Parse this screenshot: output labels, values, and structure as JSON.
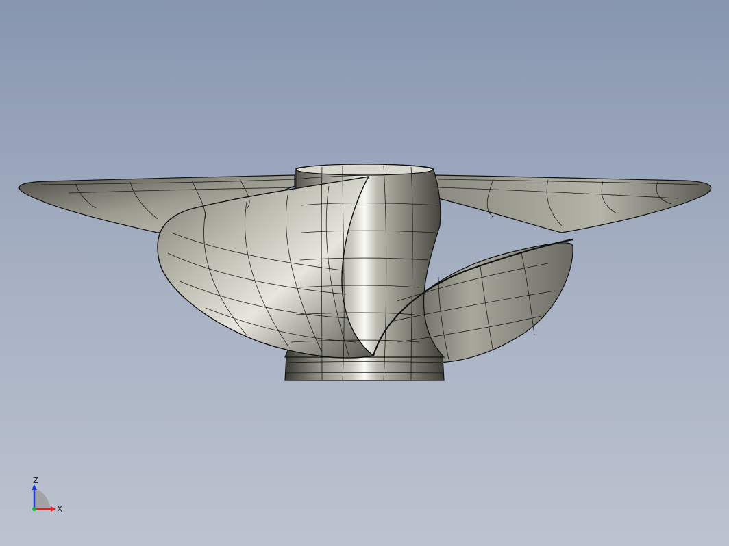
{
  "viewport": {
    "background_top": "#8796b0",
    "background_bottom": "#bcc3d0"
  },
  "model": {
    "name": "propeller",
    "surface_color": "#8f8f86",
    "edge_color": "#111111"
  },
  "triad": {
    "z_label": "Z",
    "x_label": "X",
    "z_color": "#1f3fd6",
    "x_color": "#e02020",
    "y_color": "#20b040"
  }
}
